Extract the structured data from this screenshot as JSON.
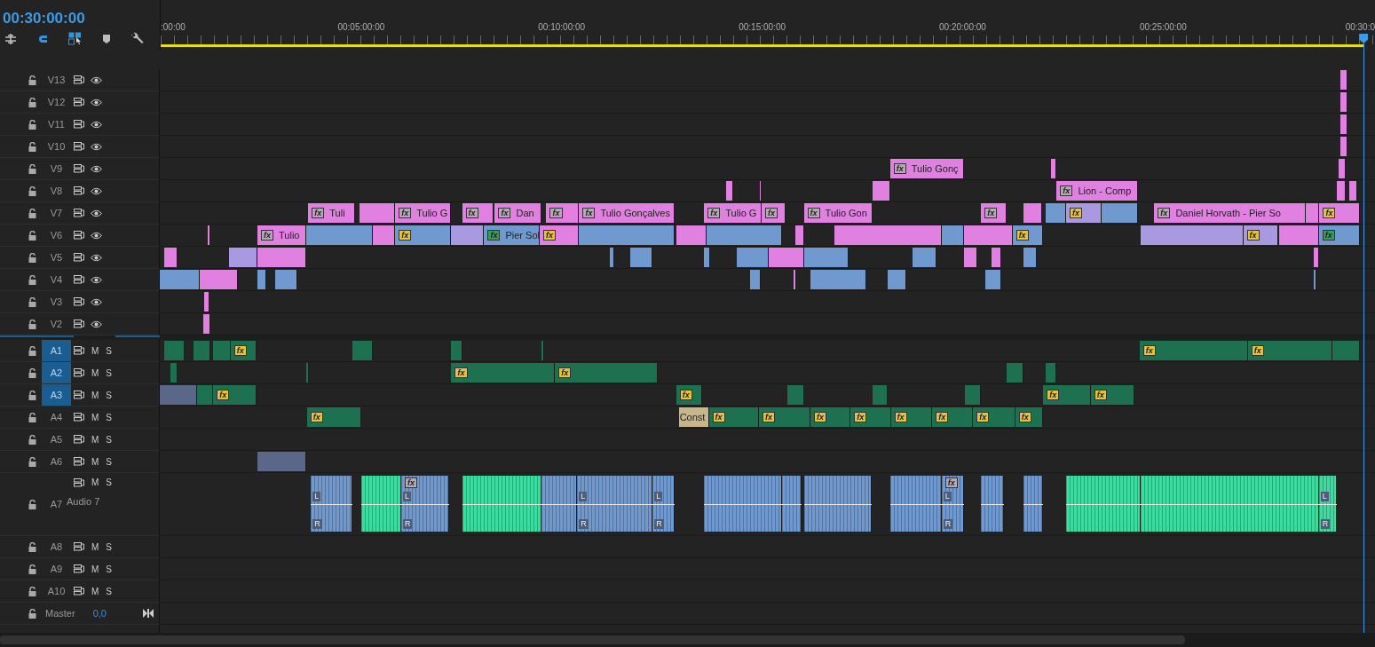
{
  "timecode": "00:30:00:00",
  "tools": [
    {
      "kind": "insert",
      "on": false
    },
    {
      "kind": "snap",
      "on": true
    },
    {
      "kind": "linked",
      "on": true
    },
    {
      "kind": "marker",
      "on": false
    },
    {
      "kind": "settings",
      "on": false
    }
  ],
  "ruler": [
    ":00:00",
    "00:05:00:00",
    "00:10:00:00",
    "00:15:00:00",
    "00:20:00:00",
    "00:25:00:00",
    "00:30:0"
  ],
  "tracks": [
    {
      "kind": "video",
      "name": "V13",
      "targeted": false,
      "clips": [
        {
          "color": "#e080e0"
        }
      ]
    },
    {
      "kind": "video",
      "name": "V12",
      "targeted": false,
      "clips": [
        {
          "color": "#e080e0"
        }
      ]
    },
    {
      "kind": "video",
      "name": "V11",
      "targeted": false,
      "clips": [
        {
          "color": "#e080e0"
        }
      ]
    },
    {
      "kind": "video",
      "name": "V10",
      "targeted": false,
      "clips": [
        {
          "color": "#e080e0"
        }
      ]
    },
    {
      "kind": "video",
      "name": "V9",
      "targeted": false,
      "clips": [
        {
          "color": "#e080e0",
          "fx": {
            "text": "fx",
            "kind": "intrinsic"
          },
          "label": "Tulio Gonç"
        },
        {
          "color": "#e080e0"
        },
        {
          "color": "#e080e0"
        }
      ]
    },
    {
      "kind": "video",
      "name": "V8",
      "targeted": false,
      "clips": [
        {
          "color": "#e080e0"
        },
        {
          "color": "#e080e0"
        },
        {
          "color": "#e080e0"
        },
        {
          "color": "#e080e0",
          "fx": {
            "text": "fx",
            "kind": "intrinsic"
          },
          "label": "Lion - Comp"
        },
        {
          "color": "#e080e0"
        },
        {
          "color": "#e080e0"
        }
      ]
    },
    {
      "kind": "video",
      "name": "V7",
      "targeted": false,
      "clips": [
        {
          "color": "#e080e0",
          "fx": {
            "text": "fx",
            "kind": "intrinsic"
          },
          "label": "Tuli"
        },
        {
          "color": "#e080e0"
        },
        {
          "color": "#e080e0",
          "fx": {
            "text": "fx",
            "kind": "intrinsic"
          },
          "label": "Tulio G"
        },
        {
          "color": "#e080e0",
          "fx": {
            "text": "fx",
            "kind": "intrinsic"
          }
        },
        {
          "color": "#e080e0",
          "fx": {
            "text": "fx",
            "kind": "intrinsic"
          },
          "label": "Dan"
        },
        {
          "color": "#e080e0",
          "fx": {
            "text": "fx",
            "kind": "intrinsic"
          }
        },
        {
          "color": "#e080e0",
          "fx": {
            "text": "fx",
            "kind": "intrinsic"
          },
          "label": "Tulio Gonçalves"
        },
        {
          "color": "#e080e0",
          "fx": {
            "text": "fx",
            "kind": "intrinsic"
          },
          "label": "Tulio G"
        },
        {
          "color": "#e080e0",
          "fx": {
            "text": "fx",
            "kind": "intrinsic"
          }
        },
        {
          "color": "#e080e0",
          "fx": {
            "text": "fx",
            "kind": "intrinsic"
          },
          "label": "Tulio Gon"
        },
        {
          "color": "#e080e0",
          "fx": {
            "text": "fx",
            "kind": "intrinsic"
          }
        },
        {
          "color": "#e080e0"
        },
        {
          "color": "#7099cf"
        },
        {
          "color": "#a899e0",
          "fx": {
            "text": "fx",
            "kind": "applied"
          }
        },
        {
          "color": "#7099cf"
        },
        {
          "color": "#e080e0",
          "fx": {
            "text": "fx",
            "kind": "intrinsic"
          },
          "label": "Daniel Horvath - Pier So"
        },
        {
          "color": "#e080e0"
        },
        {
          "color": "#e080e0",
          "fx": {
            "text": "fx",
            "kind": "applied"
          }
        }
      ]
    },
    {
      "kind": "video",
      "name": "V6",
      "targeted": false,
      "clips": [
        {
          "color": "#e080e0"
        },
        {
          "color": "#e080e0",
          "fx": {
            "text": "fx",
            "kind": "intrinsic"
          },
          "label": "Tulio"
        },
        {
          "color": "#7099cf"
        },
        {
          "color": "#e080e0"
        },
        {
          "color": "#7099cf",
          "fx": {
            "text": "fx",
            "kind": "applied"
          }
        },
        {
          "color": "#a899e0"
        },
        {
          "color": "#7099cf",
          "fx": {
            "text": "fx",
            "kind": "keyed"
          },
          "label": "Pier Sol"
        },
        {
          "color": "#e080e0",
          "fx": {
            "text": "fx",
            "kind": "applied"
          }
        },
        {
          "color": "#7099cf"
        },
        {
          "color": "#e080e0"
        },
        {
          "color": "#7099cf"
        },
        {
          "color": "#e080e0"
        },
        {
          "color": "#e080e0"
        },
        {
          "color": "#7099cf"
        },
        {
          "color": "#e080e0"
        },
        {
          "color": "#7099cf",
          "fx": {
            "text": "fx",
            "kind": "applied"
          }
        },
        {
          "color": "#a899e0"
        },
        {
          "color": "#a899e0",
          "fx": {
            "text": "fx",
            "kind": "applied"
          }
        },
        {
          "color": "#e080e0"
        },
        {
          "color": "#7099cf",
          "fx": {
            "text": "fx",
            "kind": "keyed"
          }
        }
      ]
    },
    {
      "kind": "video",
      "name": "V5",
      "targeted": false,
      "clips": [
        {
          "color": "#e080e0"
        },
        {
          "color": "#a899e0"
        },
        {
          "color": "#e080e0"
        },
        {
          "color": "#7099cf"
        },
        {
          "color": "#7099cf"
        },
        {
          "color": "#7099cf"
        },
        {
          "color": "#7099cf"
        },
        {
          "color": "#e080e0"
        },
        {
          "color": "#7099cf"
        },
        {
          "color": "#7099cf"
        },
        {
          "color": "#e080e0"
        },
        {
          "color": "#e080e0"
        },
        {
          "color": "#7099cf"
        },
        {
          "color": "#e080e0"
        }
      ]
    },
    {
      "kind": "video",
      "name": "V4",
      "targeted": false,
      "clips": [
        {
          "color": "#7099cf"
        },
        {
          "color": "#e080e0"
        },
        {
          "color": "#7099cf"
        },
        {
          "color": "#7099cf"
        },
        {
          "color": "#7099cf"
        },
        {
          "color": "#e080e0"
        },
        {
          "color": "#7099cf"
        },
        {
          "color": "#7099cf"
        },
        {
          "color": "#7099cf"
        },
        {
          "color": "#7099cf"
        }
      ]
    },
    {
      "kind": "video",
      "name": "V3",
      "targeted": false,
      "clips": [
        {
          "color": "#e080e0"
        }
      ]
    },
    {
      "kind": "video",
      "name": "V2",
      "targeted": false,
      "clips": [
        {
          "color": "#e080e0"
        }
      ]
    },
    {
      "kind": "audio",
      "name": "A1",
      "targeted": true,
      "expanded": false,
      "buttons": [
        "M",
        "S"
      ],
      "clips": [
        {
          "color": "#1d7150"
        },
        {
          "color": "#1d7150"
        },
        {
          "color": "#1d7150"
        },
        {
          "color": "#1d7150",
          "fx": {
            "text": "fx",
            "kind": "applied"
          }
        },
        {
          "color": "#1d7150"
        },
        {
          "color": "#1d7150"
        },
        {
          "color": "#1d7150"
        },
        {
          "color": "#1d7150",
          "fx": {
            "text": "fx",
            "kind": "applied"
          }
        },
        {
          "color": "#1d7150",
          "fx": {
            "text": "fx",
            "kind": "applied"
          }
        },
        {
          "color": "#1d7150"
        }
      ]
    },
    {
      "kind": "audio",
      "name": "A2",
      "targeted": true,
      "expanded": false,
      "buttons": [
        "M",
        "S"
      ],
      "clips": [
        {
          "color": "#1d7150"
        },
        {
          "color": "#1d7150"
        },
        {
          "color": "#1d7150",
          "fx": {
            "text": "fx",
            "kind": "applied"
          }
        },
        {
          "color": "#1d7150",
          "fx": {
            "text": "fx",
            "kind": "applied"
          }
        },
        {
          "color": "#1d7150"
        },
        {
          "color": "#1d7150"
        }
      ]
    },
    {
      "kind": "audio",
      "name": "A3",
      "targeted": true,
      "expanded": false,
      "buttons": [
        "M",
        "S"
      ],
      "clips": [
        {
          "color": "#5a6788"
        },
        {
          "color": "#1d7150"
        },
        {
          "color": "#1d7150",
          "fx": {
            "text": "fx",
            "kind": "applied"
          }
        },
        {
          "color": "#1d7150",
          "fx": {
            "text": "fx",
            "kind": "applied"
          }
        },
        {
          "color": "#1d7150"
        },
        {
          "color": "#1d7150"
        },
        {
          "color": "#1d7150"
        },
        {
          "color": "#1d7150",
          "fx": {
            "text": "fx",
            "kind": "applied"
          }
        },
        {
          "color": "#1d7150",
          "fx": {
            "text": "fx",
            "kind": "applied"
          }
        }
      ]
    },
    {
      "kind": "audio",
      "name": "A4",
      "targeted": false,
      "expanded": false,
      "buttons": [
        "M",
        "S"
      ],
      "clips": [
        {
          "color": "#1d7150",
          "fx": {
            "text": "fx",
            "kind": "applied"
          }
        },
        {
          "color": "#c8b68a",
          "label": "Const"
        },
        {
          "color": "#1d7150",
          "fx": {
            "text": "fx",
            "kind": "applied"
          }
        },
        {
          "color": "#1d7150",
          "fx": {
            "text": "fx",
            "kind": "applied"
          }
        },
        {
          "color": "#1d7150",
          "fx": {
            "text": "fx",
            "kind": "applied"
          }
        },
        {
          "color": "#1d7150",
          "fx": {
            "text": "fx",
            "kind": "applied"
          }
        },
        {
          "color": "#1d7150",
          "fx": {
            "text": "fx",
            "kind": "applied"
          }
        },
        {
          "color": "#1d7150",
          "fx": {
            "text": "fx",
            "kind": "applied"
          }
        },
        {
          "color": "#1d7150",
          "fx": {
            "text": "fx",
            "kind": "applied"
          }
        },
        {
          "color": "#1d7150",
          "fx": {
            "text": "fx",
            "kind": "applied"
          }
        }
      ]
    },
    {
      "kind": "audio",
      "name": "A5",
      "targeted": false,
      "expanded": false,
      "buttons": [
        "M",
        "S"
      ]
    },
    {
      "kind": "audio",
      "name": "A6",
      "targeted": false,
      "expanded": false,
      "buttons": [
        "M",
        "S"
      ],
      "clips": [
        {
          "color": "#5a6788"
        }
      ]
    },
    {
      "kind": "audio",
      "name": "A7",
      "targeted": false,
      "buttons": [
        "M",
        "S"
      ],
      "label": "Audio 7",
      "expanded": true,
      "clips": [
        {
          "color": "#7099cf",
          "channels": [
            "L",
            "R"
          ]
        },
        {
          "color": "#3ddba0"
        },
        {
          "color": "#7099cf",
          "fx": {
            "text": "fx",
            "kind": "intrinsic"
          },
          "channels": [
            "L",
            "R"
          ]
        },
        {
          "color": "#3ddba0"
        },
        {
          "color": "#7099cf"
        },
        {
          "color": "#7099cf",
          "channels": [
            "L",
            "R"
          ]
        },
        {
          "color": "#7099cf",
          "channels": [
            "L",
            "R"
          ]
        },
        {
          "color": "#7099cf"
        },
        {
          "color": "#7099cf"
        },
        {
          "color": "#7099cf"
        },
        {
          "color": "#7099cf"
        },
        {
          "color": "#7099cf",
          "fx": {
            "text": "fx",
            "kind": "intrinsic"
          },
          "channels": [
            "L",
            "R"
          ]
        },
        {
          "color": "#7099cf"
        },
        {
          "color": "#7099cf"
        },
        {
          "color": "#3ddba0"
        },
        {
          "color": "#3ddba0"
        },
        {
          "color": "#3ddba0",
          "channels": [
            "L",
            "R"
          ]
        }
      ]
    },
    {
      "kind": "audio",
      "name": "A8",
      "targeted": false,
      "expanded": false,
      "buttons": [
        "M",
        "S"
      ]
    },
    {
      "kind": "audio",
      "name": "A9",
      "targeted": false,
      "expanded": false,
      "buttons": [
        "M",
        "S"
      ]
    },
    {
      "kind": "audio",
      "name": "A10",
      "targeted": false,
      "expanded": false,
      "buttons": [
        "M",
        "S"
      ]
    }
  ],
  "master": {
    "name": "Master",
    "value": "0,0"
  }
}
